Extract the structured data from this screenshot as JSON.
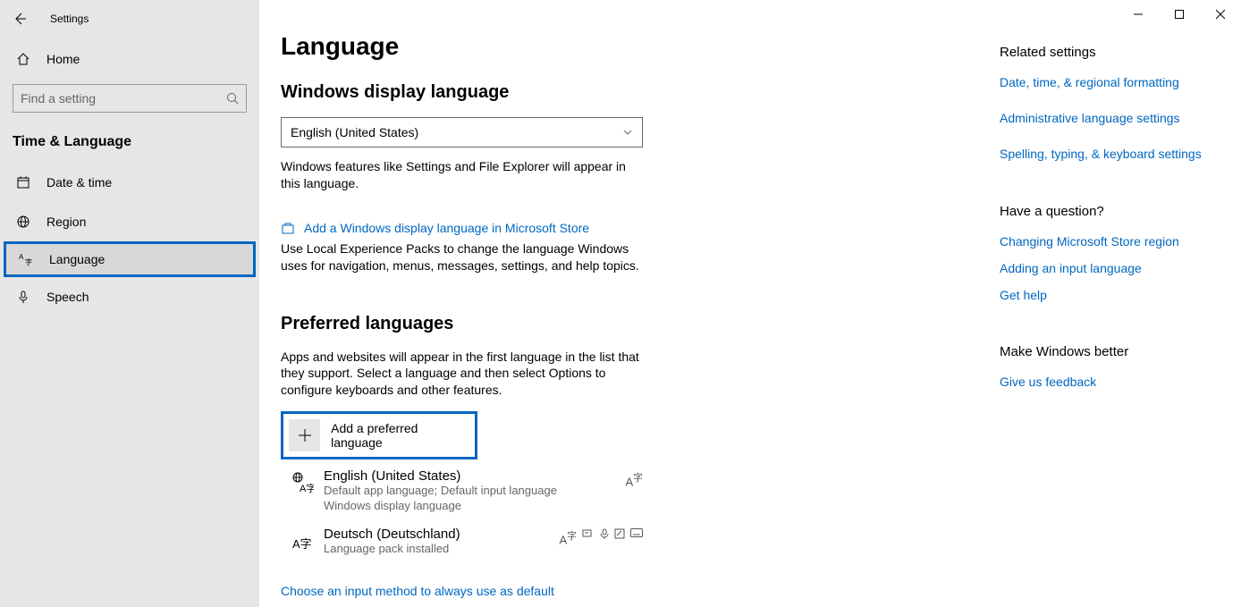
{
  "header": {
    "settings_title": "Settings"
  },
  "sidebar": {
    "home_label": "Home",
    "search_placeholder": "Find a setting",
    "category": "Time & Language",
    "items": [
      {
        "label": "Date & time",
        "icon": "clock-icon"
      },
      {
        "label": "Region",
        "icon": "globe-icon"
      },
      {
        "label": "Language",
        "icon": "language-icon",
        "highlighted": true
      },
      {
        "label": "Speech",
        "icon": "microphone-icon"
      }
    ]
  },
  "main": {
    "title": "Language",
    "display_language": {
      "heading": "Windows display language",
      "selected": "English (United States)",
      "helper": "Windows features like Settings and File Explorer will appear in this language.",
      "store_link": "Add a Windows display language in Microsoft Store",
      "store_helper": "Use Local Experience Packs to change the language Windows uses for navigation, menus, messages, settings, and help topics."
    },
    "preferred": {
      "heading": "Preferred languages",
      "helper": "Apps and websites will appear in the first language in the list that they support. Select a language and then select Options to configure keyboards and other features.",
      "add_label": "Add a preferred language",
      "languages": [
        {
          "name": "English (United States)",
          "sub1": "Default app language; Default input language",
          "sub2": "Windows display language",
          "feature_icons": [
            "language-icon"
          ]
        },
        {
          "name": "Deutsch (Deutschland)",
          "sub1": "Language pack installed",
          "sub2": "",
          "feature_icons": [
            "language-icon",
            "tts-icon",
            "speech-icon",
            "handwriting-icon",
            "keyboard-icon"
          ]
        }
      ],
      "input_method_link": "Choose an input method to always use as default"
    }
  },
  "right": {
    "related_heading": "Related settings",
    "related_links": [
      "Date, time, & regional formatting",
      "Administrative language settings",
      "Spelling, typing, & keyboard settings"
    ],
    "question_heading": "Have a question?",
    "question_links": [
      "Changing Microsoft Store region",
      "Adding an input language",
      "Get help"
    ],
    "better_heading": "Make Windows better",
    "better_links": [
      "Give us feedback"
    ]
  }
}
